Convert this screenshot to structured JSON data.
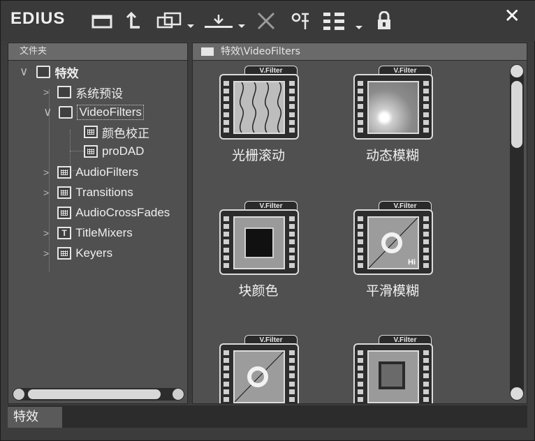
{
  "app": {
    "title": "EDIUS"
  },
  "toolbar": {
    "close": "✕",
    "icons": [
      "new-folder-icon",
      "up-folder-icon",
      "copy-icon",
      "import-icon",
      "delete-icon",
      "properties-icon",
      "view-icon",
      "lock-icon"
    ]
  },
  "left_pane": {
    "header": "文件夹",
    "tree": [
      {
        "label": "特效",
        "level": 0,
        "expanded": true
      },
      {
        "label": "系统预设",
        "level": 1
      },
      {
        "label": "VideoFilters",
        "level": 1,
        "expanded": true,
        "selected": true
      },
      {
        "label": "颜色校正",
        "level": 2
      },
      {
        "label": "proDAD",
        "level": 2
      },
      {
        "label": "AudioFilters",
        "level": 1
      },
      {
        "label": "Transitions",
        "level": 1
      },
      {
        "label": "AudioCrossFades",
        "level": 1
      },
      {
        "label": "TitleMixers",
        "level": 1
      },
      {
        "label": "Keyers",
        "level": 1
      }
    ]
  },
  "right_pane": {
    "path": "特效\\VideoFilters",
    "tag": "V.Filter",
    "filters": [
      {
        "label": "光栅滚动"
      },
      {
        "label": "动态模糊"
      },
      {
        "label": "块颜色"
      },
      {
        "label": "平滑模糊",
        "badge": "Hi"
      },
      {
        "label": ""
      },
      {
        "label": ""
      }
    ]
  },
  "status_bar": {
    "tab": "特效"
  }
}
